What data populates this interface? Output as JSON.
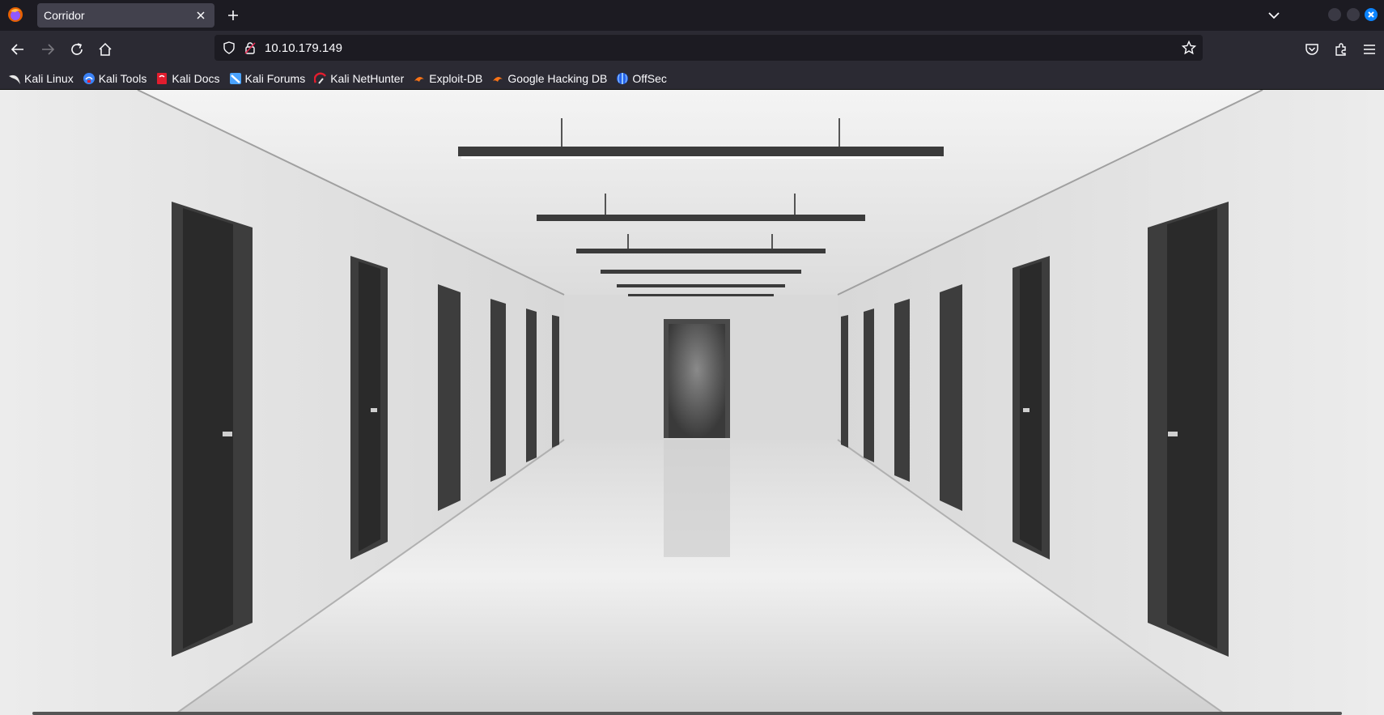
{
  "tab": {
    "title": "Corridor"
  },
  "navigation": {
    "url": "10.10.179.149"
  },
  "bookmarks": [
    {
      "label": "Kali Linux",
      "icon": "kali-dragon-icon",
      "color": "#e8e8e8"
    },
    {
      "label": "Kali Tools",
      "icon": "kali-tools-icon",
      "color": "#3b82f6"
    },
    {
      "label": "Kali Docs",
      "icon": "kali-docs-icon",
      "color": "#e11d2e"
    },
    {
      "label": "Kali Forums",
      "icon": "kali-forums-icon",
      "color": "#4aa3ff"
    },
    {
      "label": "Kali NetHunter",
      "icon": "kali-nethunter-icon",
      "color": "#e11d2e"
    },
    {
      "label": "Exploit-DB",
      "icon": "exploit-db-icon",
      "color": "#f97316"
    },
    {
      "label": "Google Hacking DB",
      "icon": "ghdb-icon",
      "color": "#f97316"
    },
    {
      "label": "OffSec",
      "icon": "offsec-icon",
      "color": "#2563eb"
    }
  ],
  "colors": {
    "chrome_dark": "#1c1b22",
    "chrome": "#2b2a33",
    "tab_active": "#42414d",
    "text": "#fbfbfe",
    "close_button": "#0b84ff"
  }
}
